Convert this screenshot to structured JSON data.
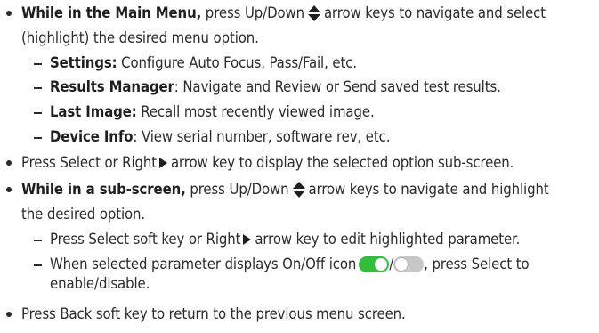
{
  "items": {
    "main_menu": {
      "bold": "While in the Main Menu,",
      "text_a": " press Up/Down",
      "text_b": "arrow keys to navigate and select",
      "cont": "(highlight) the desired menu option."
    },
    "settings": {
      "bold": "Settings:",
      "text": " Configure Auto Focus, Pass/Fail, etc."
    },
    "results": {
      "bold": "Results Manager",
      "text": ": Navigate and Review or Send saved test results."
    },
    "last_image": {
      "bold": "Last Image:",
      "text": " Recall most recently viewed image."
    },
    "device_info": {
      "bold": "Device Info",
      "text": ": View serial number, software rev, etc."
    },
    "press_select": {
      "text_a": "Press Select or Right",
      "text_b": "arrow key to display the selected option sub-screen."
    },
    "sub_screen": {
      "bold": "While in a sub-screen,",
      "text_a": " press Up/Down",
      "text_b": "arrow keys to navigate and highlight",
      "cont": "the desired option."
    },
    "edit_param": {
      "text_a": "Press Select soft key or Right",
      "text_b": "arrow key to edit highlighted parameter."
    },
    "toggle_param": {
      "text_a": "When selected parameter displays On/Off icon",
      "slash": "/",
      "text_b": ", press Select to",
      "cont": "enable/disable."
    },
    "back": {
      "text": "Press Back soft key to return to the previous menu screen."
    }
  },
  "icons": {
    "updown": "up-down-arrow-icon",
    "right": "right-arrow-icon",
    "toggle_on": "toggle-on-icon",
    "toggle_off": "toggle-off-icon"
  },
  "colors": {
    "text": "#2b2b2b",
    "toggle_on": "#2fbf3a",
    "toggle_off": "#c7c7c7"
  }
}
